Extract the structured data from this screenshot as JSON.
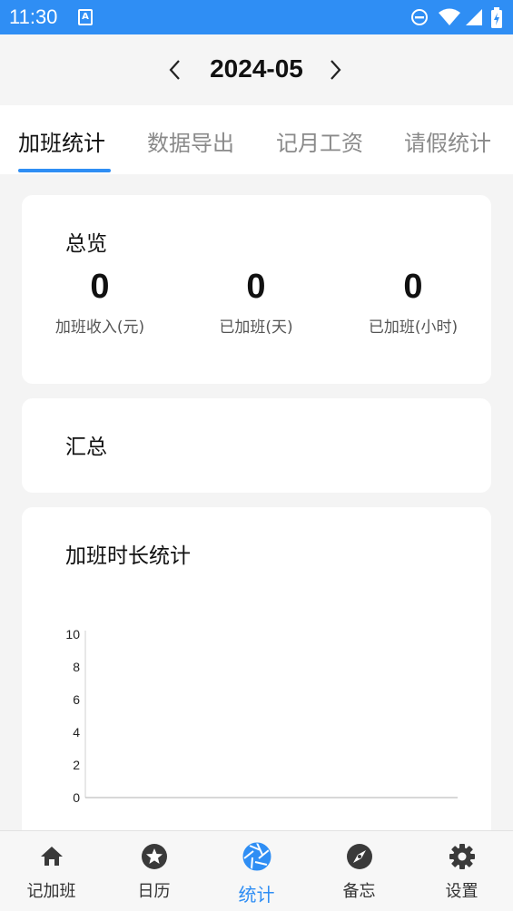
{
  "status_bar": {
    "time": "11:30",
    "notification_icon": "a-box-icon",
    "icons": [
      "dnd-icon",
      "wifi-icon",
      "signal-icon",
      "battery-icon"
    ]
  },
  "header": {
    "month": "2024-05",
    "prev_icon": "chevron-left-icon",
    "next_icon": "chevron-right-icon"
  },
  "tabs": [
    {
      "label": "加班统计",
      "active": true
    },
    {
      "label": "数据导出",
      "active": false
    },
    {
      "label": "记月工资",
      "active": false
    },
    {
      "label": "请假统计",
      "active": false
    }
  ],
  "overview": {
    "title": "总览",
    "stats": [
      {
        "value": "0",
        "label": "加班收入(元)"
      },
      {
        "value": "0",
        "label": "已加班(天)"
      },
      {
        "value": "0",
        "label": "已加班(小时)"
      }
    ]
  },
  "summary": {
    "title": "汇总"
  },
  "duration_chart": {
    "title": "加班时长统计"
  },
  "chart_data": {
    "type": "bar",
    "title": "加班时长统计",
    "categories": [],
    "series": [],
    "ylim": [
      0,
      10
    ],
    "yticks": [
      "0",
      "2",
      "4",
      "6",
      "8",
      "10"
    ],
    "grid": false
  },
  "bottom_nav": [
    {
      "label": "记加班",
      "icon": "home-icon",
      "active": false
    },
    {
      "label": "日历",
      "icon": "star-icon",
      "active": false
    },
    {
      "label": "统计",
      "icon": "aperture-icon",
      "active": true
    },
    {
      "label": "备忘",
      "icon": "compass-icon",
      "active": false
    },
    {
      "label": "设置",
      "icon": "gear-icon",
      "active": false
    }
  ],
  "colors": {
    "accent": "#2f8ef4",
    "status_bar": "#2f8ef4",
    "background": "#f4f4f4",
    "inactive_text": "#8a8a8a"
  }
}
